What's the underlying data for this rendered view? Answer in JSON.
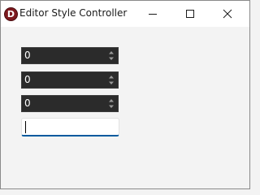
{
  "window": {
    "title": "Editor Style Controller",
    "icon_letter": "D",
    "icon_color": "#7d1a1f"
  },
  "controls": {
    "number_fields": [
      {
        "value": "0"
      },
      {
        "value": "0"
      },
      {
        "value": "0"
      }
    ],
    "text_field": {
      "value": "",
      "focused": true
    }
  },
  "colors": {
    "numbox_background": "#2b2b2b",
    "focus_accent": "#005a9e"
  },
  "icons": [
    "app-icon",
    "minimize-icon",
    "maximize-icon",
    "close-icon",
    "spin-up-icon",
    "spin-down-icon"
  ]
}
